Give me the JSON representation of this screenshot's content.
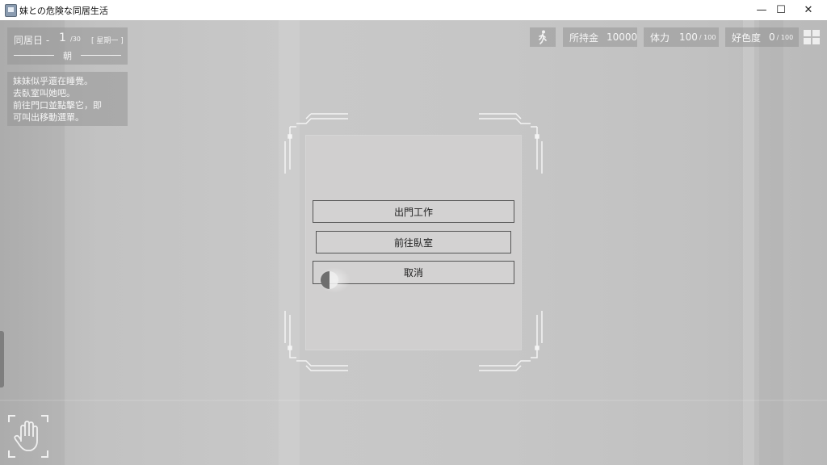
{
  "window": {
    "title": "妹との危険な同居生活",
    "minimize_glyph": "—",
    "maximize_glyph": "☐",
    "close_glyph": "✕"
  },
  "hud": {
    "day_label": "同居日 -",
    "day_number": "1",
    "day_total": "/30",
    "weekday": "[ 星期一 ]",
    "time_of_day": "朝",
    "message_lines": [
      "妹妹似乎還在睡覺。",
      "去臥室叫她吧。",
      "前往門口並點擊它，即",
      "可叫出移動選單。"
    ],
    "money": {
      "label": "所持金",
      "value": "10000"
    },
    "stamina": {
      "label": "体力",
      "value": "100",
      "max": "/ 100"
    },
    "affection": {
      "label": "好色度",
      "value": "0",
      "max": "/ 100"
    },
    "icons": {
      "walk": "walk-icon",
      "menu": "grid-menu-icon",
      "hand": "hand-icon"
    }
  },
  "dialog": {
    "options": [
      "出門工作",
      "前往臥室",
      "取消"
    ]
  },
  "colors": {
    "panel": "#969696",
    "dialog_bg": "#d0cfcf",
    "button_border": "#555555",
    "text_light": "#f4f4f4"
  }
}
